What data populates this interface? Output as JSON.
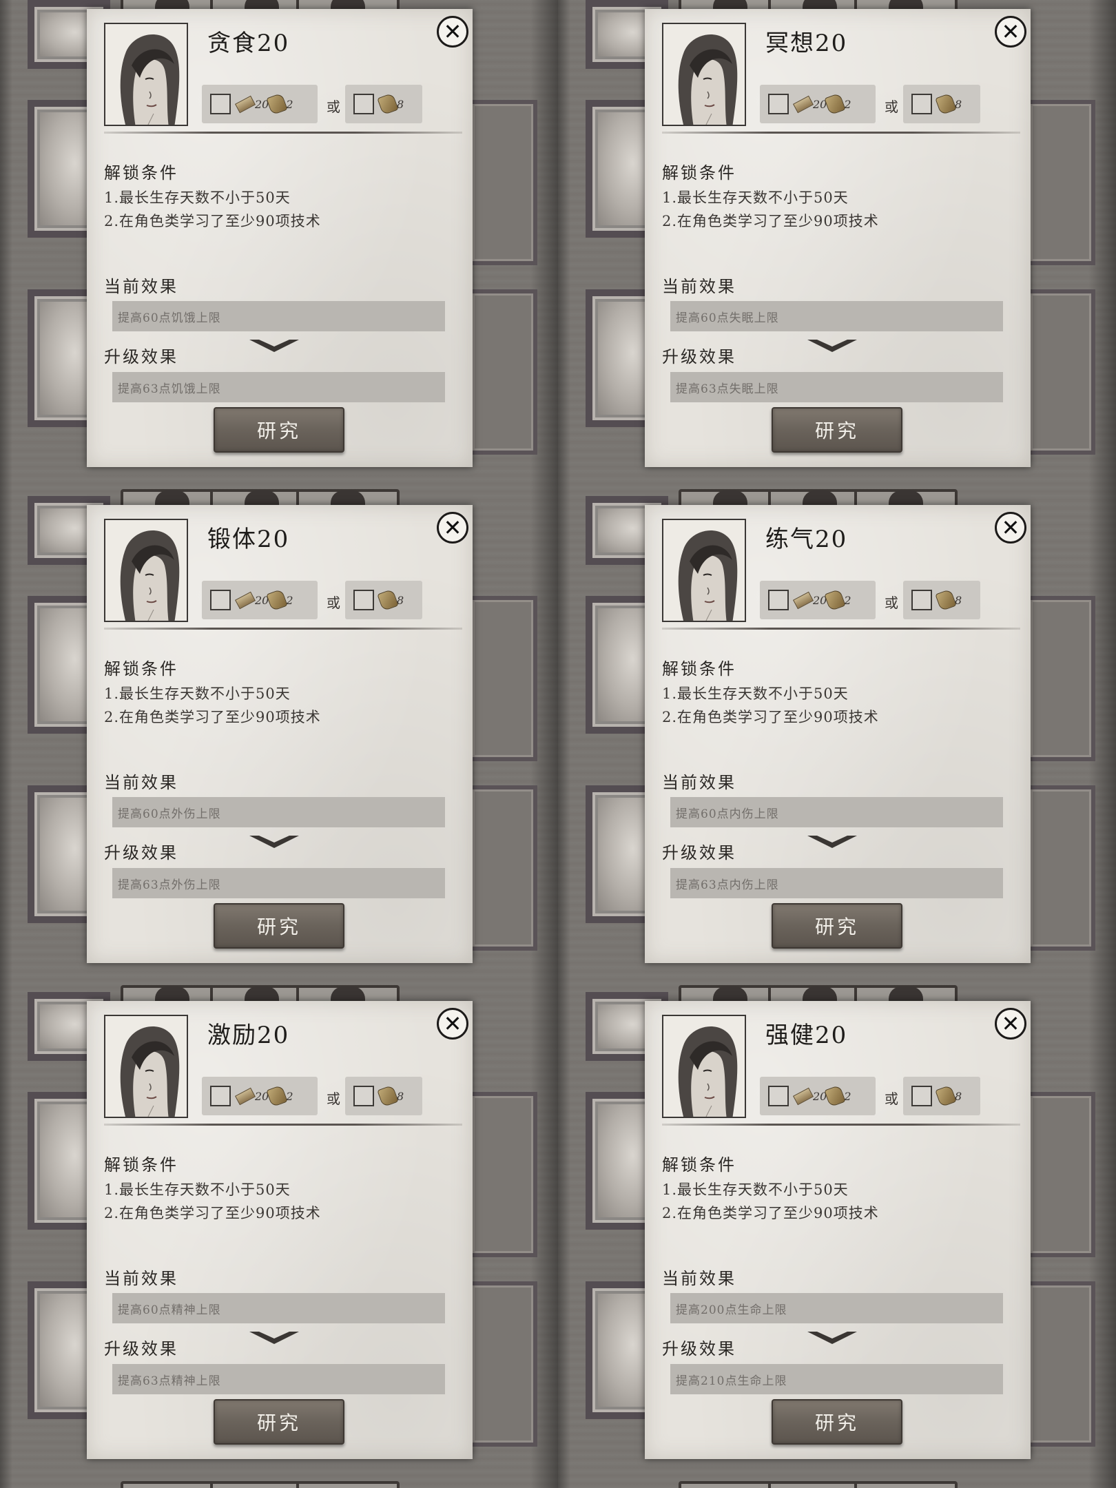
{
  "common": {
    "cost_wood": "20",
    "cost_scroll": "2",
    "or_word": "或",
    "alt_scroll": "8",
    "unlock_header": "解锁条件",
    "unlock_line1": "1.最长生存天数不小于50天",
    "unlock_line2": "2.在角色类学习了至少90项技术",
    "current_header": "当前效果",
    "upgrade_header": "升级效果",
    "research_button": "研究",
    "close_glyph": "✕"
  },
  "panels": [
    {
      "title": "贪食20",
      "current": "提高60点饥饿上限",
      "upgrade": "提高63点饥饿上限"
    },
    {
      "title": "冥想20",
      "current": "提高60点失眠上限",
      "upgrade": "提高63点失眠上限"
    },
    {
      "title": "锻体20",
      "current": "提高60点外伤上限",
      "upgrade": "提高63点外伤上限"
    },
    {
      "title": "练气20",
      "current": "提高60点内伤上限",
      "upgrade": "提高63点内伤上限"
    },
    {
      "title": "激励20",
      "current": "提高60点精神上限",
      "upgrade": "提高63点精神上限"
    },
    {
      "title": "强健20",
      "current": "提高200点生命上限",
      "upgrade": "提高210点生命上限"
    }
  ],
  "colors": {
    "panel_bg": "#e6e3dd",
    "bar_bg": "#b9b6b1",
    "button_bg": "#6a635b",
    "background": "#7b7874"
  },
  "icons": [
    "close-icon",
    "wood-plank-icon",
    "scroll-icon",
    "chevron-down-icon",
    "portrait-female-survivor"
  ]
}
